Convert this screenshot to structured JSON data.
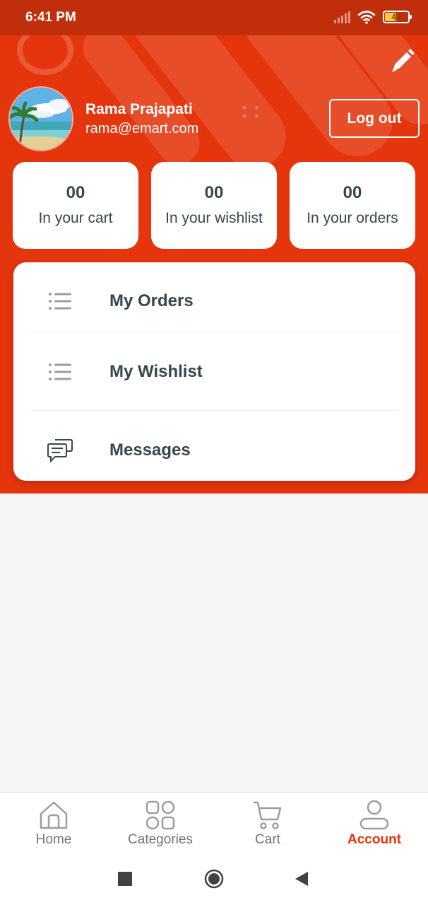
{
  "status_bar": {
    "time": "6:41 PM",
    "battery": "49",
    "battery_level": 0.49
  },
  "profile": {
    "name": "Rama Prajapati",
    "email": "rama@emart.com",
    "logout_label": "Log out"
  },
  "stats": [
    {
      "count": "00",
      "label": "In your cart"
    },
    {
      "count": "00",
      "label": "In your wishlist"
    },
    {
      "count": "00",
      "label": "In your orders"
    }
  ],
  "menu": [
    {
      "label": "My Orders",
      "icon": "list-icon"
    },
    {
      "label": "My Wishlist",
      "icon": "list-icon"
    },
    {
      "label": "Messages",
      "icon": "chat-icon"
    }
  ],
  "bottom_nav": [
    {
      "label": "Home",
      "icon": "home-icon"
    },
    {
      "label": "Categories",
      "icon": "categories-icon"
    },
    {
      "label": "Cart",
      "icon": "cart-icon"
    },
    {
      "label": "Account",
      "icon": "account-icon",
      "active": true
    }
  ],
  "colors": {
    "primary": "#e5350d",
    "status_bar": "#c12e0b",
    "text": "#37474f",
    "background": "#f5f5f7"
  }
}
